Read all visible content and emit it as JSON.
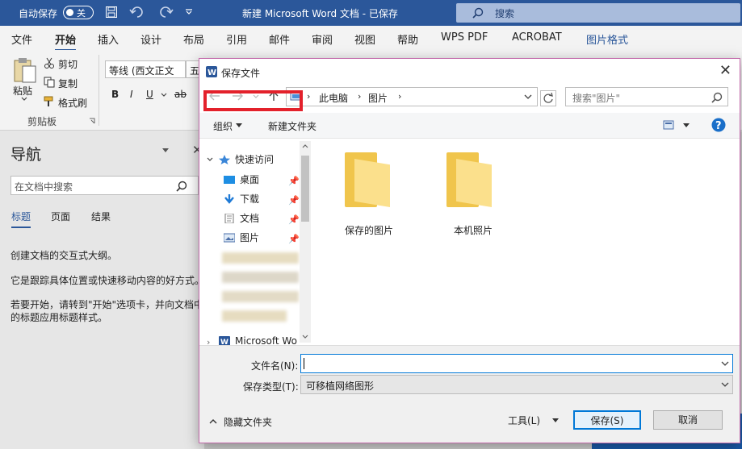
{
  "titlebar": {
    "autosave_label": "自动保存",
    "autosave_state": "关",
    "doc_title": "新建 Microsoft Word 文档 - 已保存",
    "search_placeholder": "搜索"
  },
  "tabs": [
    "文件",
    "开始",
    "插入",
    "设计",
    "布局",
    "引用",
    "邮件",
    "审阅",
    "视图",
    "帮助",
    "WPS PDF",
    "ACROBAT",
    "图片格式"
  ],
  "ribbon": {
    "paste": "粘贴",
    "cut": "剪切",
    "copy": "复制",
    "format_painter": "格式刷",
    "clipboard_group": "剪贴板",
    "font_name": "等线 (西文正文",
    "font_size": "五",
    "bold": "B",
    "italic": "I",
    "underline": "U",
    "strike": "ab"
  },
  "navpane": {
    "title": "导航",
    "search_placeholder": "在文档中搜索",
    "tabs": [
      "标题",
      "页面",
      "结果"
    ],
    "text1": "创建文档的交互式大纲。",
    "text2": "它是跟踪具体位置或快速移动内容的好方式。",
    "text3": "若要开始，请转到\"开始\"选项卡，并向文档中的标题应用标题样式。"
  },
  "dialog": {
    "title": "保存文件",
    "path": [
      "此电脑",
      "图片"
    ],
    "search_placeholder": "搜索\"图片\"",
    "organize": "组织",
    "new_folder": "新建文件夹",
    "tree": {
      "quick_access": "快速访问",
      "desktop": "桌面",
      "downloads": "下载",
      "documents": "文档",
      "pictures": "图片",
      "word": "Microsoft Wo"
    },
    "folders": [
      "保存的图片",
      "本机照片"
    ],
    "filename_label": "文件名(N):",
    "filename_value": "",
    "filetype_label": "保存类型(T):",
    "filetype_value": "可移植网络图形",
    "hide_folders": "隐藏文件夹",
    "tools": "工具(L)",
    "save": "保存(S)",
    "cancel": "取消"
  }
}
